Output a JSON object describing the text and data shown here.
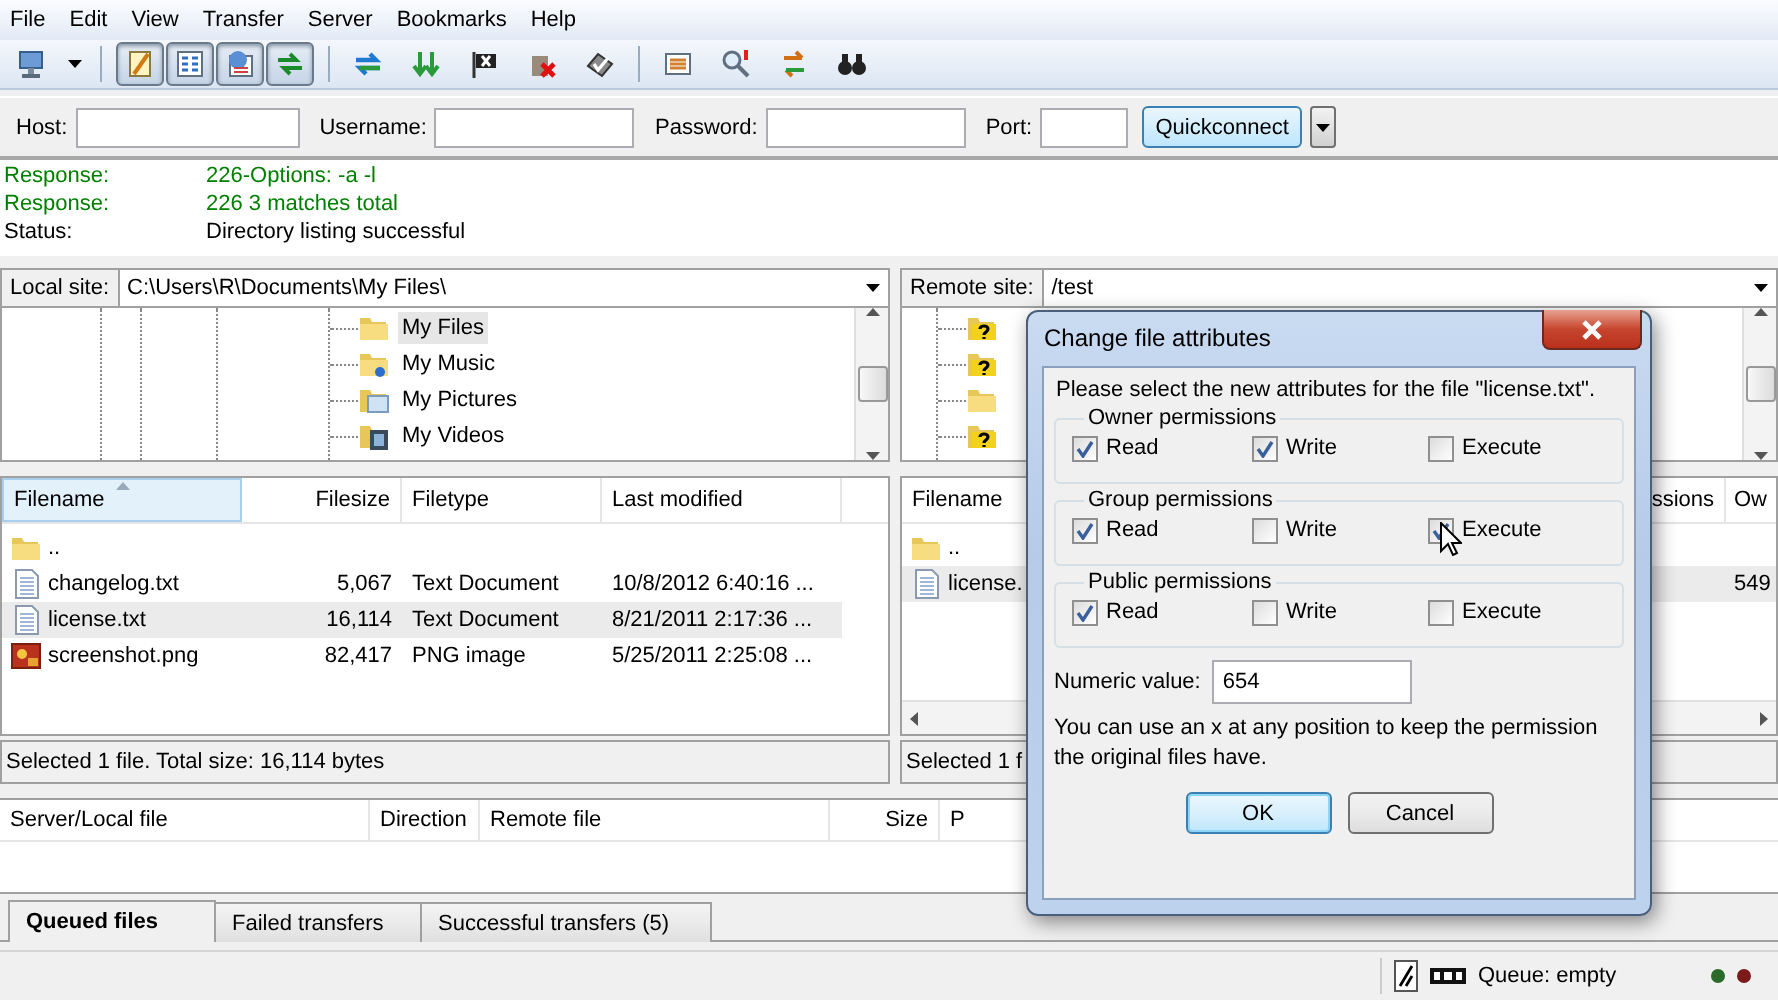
{
  "menu": [
    {
      "label": "File"
    },
    {
      "label": "Edit"
    },
    {
      "label": "View"
    },
    {
      "label": "Transfer"
    },
    {
      "label": "Server"
    },
    {
      "label": "Bookmarks"
    },
    {
      "label": "Help"
    }
  ],
  "view_toggles": [
    {
      "on": true
    },
    {
      "on": true
    },
    {
      "on": true
    },
    {
      "on": true
    }
  ],
  "quickconnect": {
    "fields": [
      {
        "label": "Host:"
      },
      {
        "label": "Username:"
      },
      {
        "label": "Password:"
      },
      {
        "label": "Port:"
      }
    ],
    "button": "Quickconnect"
  },
  "log": [
    {
      "kind": "response",
      "label": "Response:",
      "message": "226-Options: -a -l"
    },
    {
      "kind": "response",
      "label": "Response:",
      "message": "226 3 matches total"
    },
    {
      "kind": "status",
      "label": "Status:",
      "message": "Directory listing successful"
    }
  ],
  "local": {
    "label": "Local site:",
    "path": "C:\\Users\\R\\Documents\\My Files\\",
    "tree": [
      {
        "label": "My Files",
        "kind": "folder",
        "selected": true
      },
      {
        "label": "My Music",
        "kind": "music",
        "selected": false
      },
      {
        "label": "My Pictures",
        "kind": "pictures",
        "selected": false
      },
      {
        "label": "My Videos",
        "kind": "videos",
        "selected": false
      }
    ],
    "columns": [
      "Filename",
      "Filesize",
      "Filetype",
      "Last modified"
    ],
    "rows": [
      {
        "kind": "folder",
        "name": "..",
        "size": "",
        "type": "",
        "modified": "",
        "selected": false
      },
      {
        "kind": "text",
        "name": "changelog.txt",
        "size": "5,067",
        "type": "Text Document",
        "modified": "10/8/2012 6:40:16 ...",
        "selected": false
      },
      {
        "kind": "text",
        "name": "license.txt",
        "size": "16,114",
        "type": "Text Document",
        "modified": "8/21/2011 2:17:36 ...",
        "selected": true
      },
      {
        "kind": "image",
        "name": "screenshot.png",
        "size": "82,417",
        "type": "PNG image",
        "modified": "5/25/2011 2:25:08 ...",
        "selected": false
      }
    ],
    "status": "Selected 1 file. Total size: 16,114 bytes"
  },
  "remote": {
    "label": "Remote site:",
    "path": "/test",
    "tree": [
      {
        "kind": "unknown"
      },
      {
        "kind": "unknown"
      },
      {
        "kind": "folder"
      },
      {
        "kind": "unknown"
      }
    ],
    "columns": [
      "Filename",
      "ssions",
      "Ow"
    ],
    "rows": [
      {
        "kind": "folder",
        "name": "..",
        "owner": "",
        "selected": false
      },
      {
        "kind": "text",
        "name": "license.",
        "owner": "549",
        "selected": true
      }
    ],
    "status": "Selected 1 f"
  },
  "queue": {
    "columns": [
      "Server/Local file",
      "Direction",
      "Remote file",
      "Size",
      "P"
    ]
  },
  "tabs": [
    {
      "label": "Queued files",
      "selected": true
    },
    {
      "label": "Failed transfers",
      "selected": false
    },
    {
      "label": "Successful transfers (5)",
      "selected": false
    }
  ],
  "status_bar": {
    "queue": "Queue: empty"
  },
  "dialog": {
    "title": "Change file attributes",
    "intro": "Please select the new attributes for the file \"license.txt\".",
    "groups": [
      {
        "title": "Owner permissions",
        "options": [
          {
            "label": "Read",
            "checked": true
          },
          {
            "label": "Write",
            "checked": true
          },
          {
            "label": "Execute",
            "checked": false
          }
        ]
      },
      {
        "title": "Group permissions",
        "options": [
          {
            "label": "Read",
            "checked": true
          },
          {
            "label": "Write",
            "checked": false
          },
          {
            "label": "Execute",
            "checked": true
          }
        ]
      },
      {
        "title": "Public permissions",
        "options": [
          {
            "label": "Read",
            "checked": true
          },
          {
            "label": "Write",
            "checked": false
          },
          {
            "label": "Execute",
            "checked": false
          }
        ]
      }
    ],
    "numeric_label": "Numeric value:",
    "numeric_value": "654",
    "note": "You can use an x at any position to keep the permission the original files have.",
    "buttons": [
      {
        "label": "OK",
        "kind": "default"
      },
      {
        "label": "Cancel",
        "kind": "normal"
      }
    ]
  }
}
